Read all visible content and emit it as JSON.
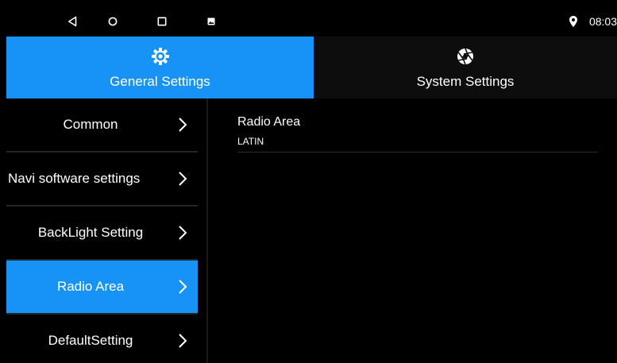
{
  "status_bar": {
    "time": "08:03",
    "icons": [
      "back-icon",
      "home-icon",
      "recents-icon",
      "gallery-icon",
      "location-icon"
    ]
  },
  "tabs": [
    {
      "label": "General Settings",
      "icon": "gear-icon",
      "active": true
    },
    {
      "label": "System Settings",
      "icon": "shutter-icon",
      "active": false
    }
  ],
  "sidebar": {
    "items": [
      {
        "label": "Common"
      },
      {
        "label": "Navi software settings"
      },
      {
        "label": "BackLight Setting"
      },
      {
        "label": "Radio Area",
        "active": true
      },
      {
        "label": "DefaultSetting"
      }
    ]
  },
  "content": {
    "setting_title": "Radio Area",
    "setting_value": "LATIN"
  },
  "colors": {
    "accent": "#1793f7",
    "background": "#000000",
    "inactive_tab": "#0d0d0d"
  }
}
